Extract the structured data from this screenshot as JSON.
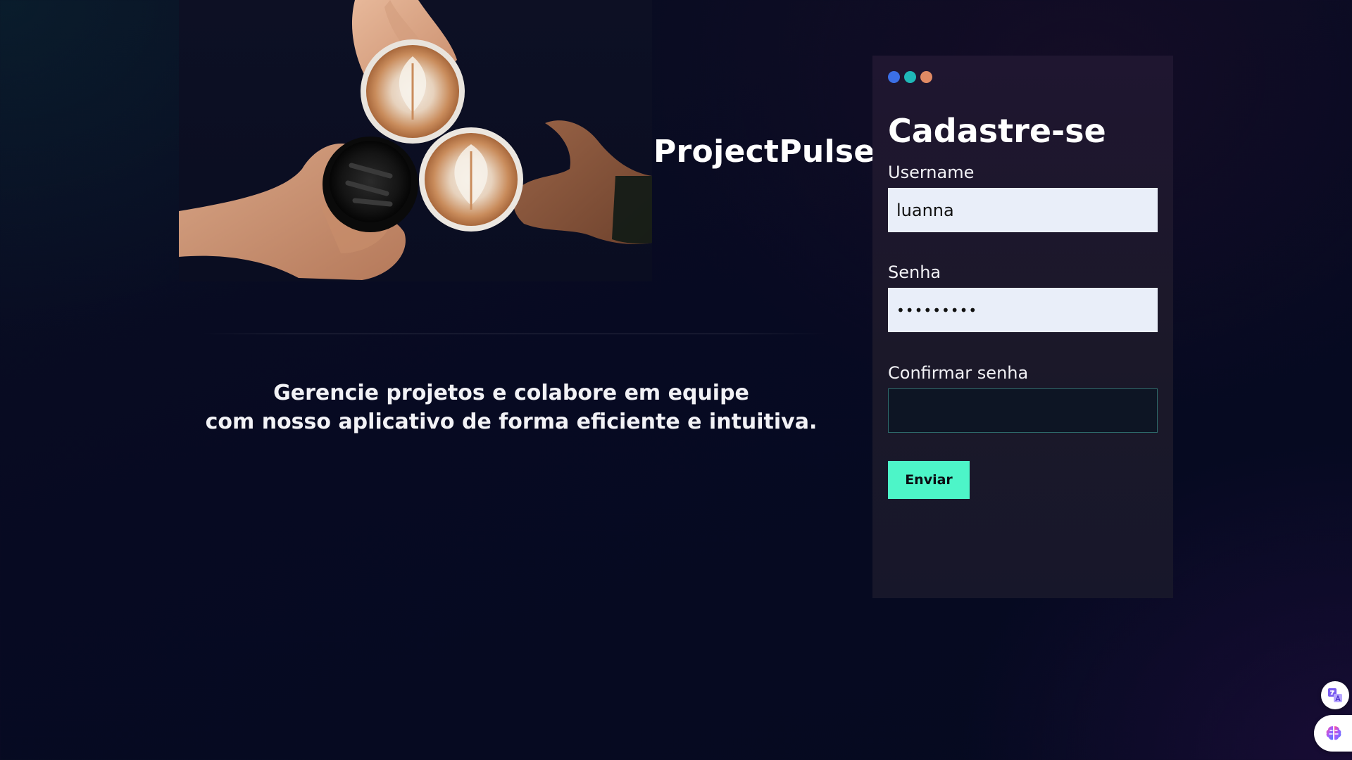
{
  "brand": {
    "title": "ProjectPulse"
  },
  "hero": {
    "image_icon": "coffee-cups-cheers-photo"
  },
  "tagline": {
    "line1": "Gerencie projetos e colabore em equipe",
    "line2": "com nosso aplicativo de forma eficiente e intuitiva."
  },
  "signup": {
    "window_dots": [
      "#3b6fe6",
      "#1fb8b8",
      "#e08a64"
    ],
    "title": "Cadastre-se",
    "username": {
      "label": "Username",
      "value": "luanna"
    },
    "password": {
      "label": "Senha",
      "value": "•••••••••"
    },
    "confirm_password": {
      "label": "Confirmar senha",
      "value": ""
    },
    "submit_label": "Enviar"
  },
  "colors": {
    "accent": "#4df5c8",
    "panel": "#1d1830",
    "input_bg": "#e9eef9"
  },
  "floating_buttons": {
    "translate_icon": "translate-icon",
    "assistant_icon": "brain-icon"
  }
}
